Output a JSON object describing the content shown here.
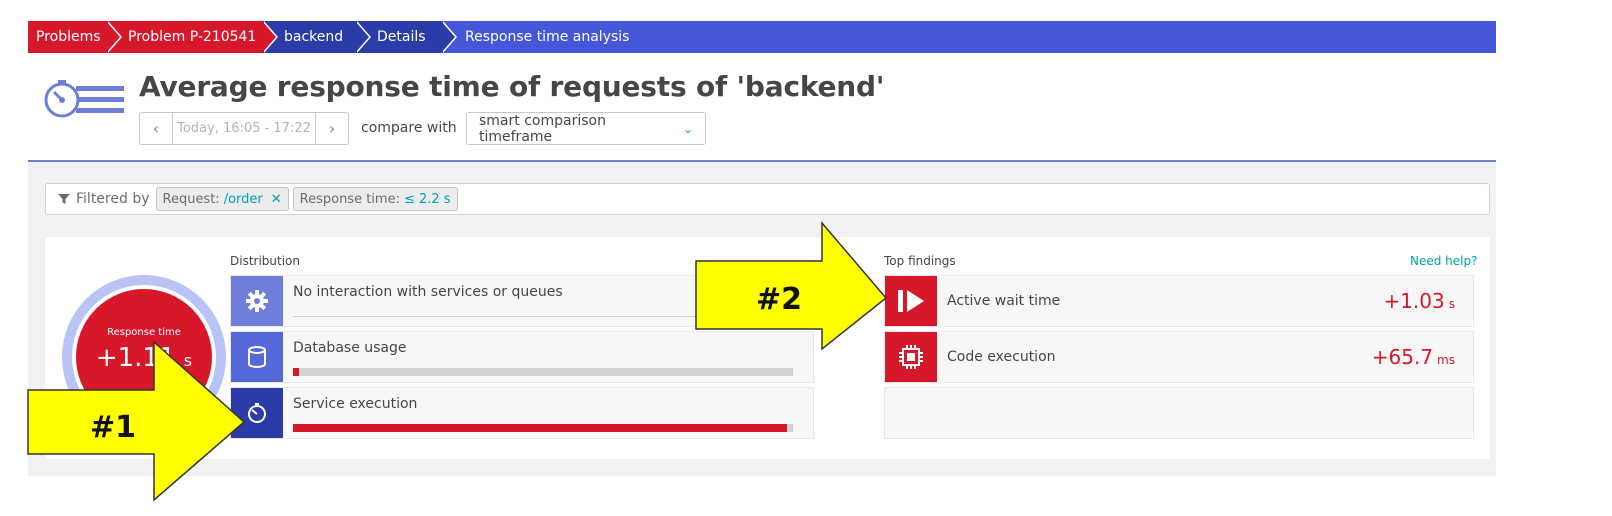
{
  "breadcrumb": {
    "items": [
      {
        "label": "Problems"
      },
      {
        "label": "Problem P-210541"
      },
      {
        "label": "backend"
      },
      {
        "label": "Details"
      },
      {
        "label": "Response time analysis"
      }
    ]
  },
  "header": {
    "title": "Average response time of requests of 'backend'",
    "timeframe": "Today, 16:05 - 17:22",
    "compare_label": "compare with",
    "compare_value": "smart comparison timeframe"
  },
  "filters": {
    "label": "Filtered by",
    "chips": [
      {
        "key": "Request:",
        "value": "/order",
        "removable": true
      },
      {
        "key": "Response time:",
        "value": "≤ 2.2 s",
        "removable": false
      }
    ]
  },
  "summary": {
    "label": "Response time",
    "value": "+1.11",
    "unit": "s"
  },
  "distribution": {
    "title": "Distribution",
    "items": [
      {
        "name": "No interaction with services or queues",
        "icon": "gear-icon",
        "fill": 0
      },
      {
        "name": "Database usage",
        "icon": "database-icon",
        "fill": 0.012
      },
      {
        "name": "Service execution",
        "icon": "stopwatch-icon",
        "fill": 0.988
      }
    ]
  },
  "findings": {
    "title": "Top findings",
    "help": "Need help?",
    "items": [
      {
        "name": "Active wait time",
        "value": "+1.03",
        "unit": "s",
        "icon": "wait-icon"
      },
      {
        "name": "Code execution",
        "value": "+65.7",
        "unit": "ms",
        "icon": "cpu-icon"
      }
    ]
  },
  "annotations": {
    "one": "#1",
    "two": "#2"
  },
  "colors": {
    "accent": "#4556d8",
    "crumb_red": "#d7182a",
    "crumb_navy": "#2b3ba7",
    "link": "#00a1b2",
    "arrow": "#ffff00"
  }
}
